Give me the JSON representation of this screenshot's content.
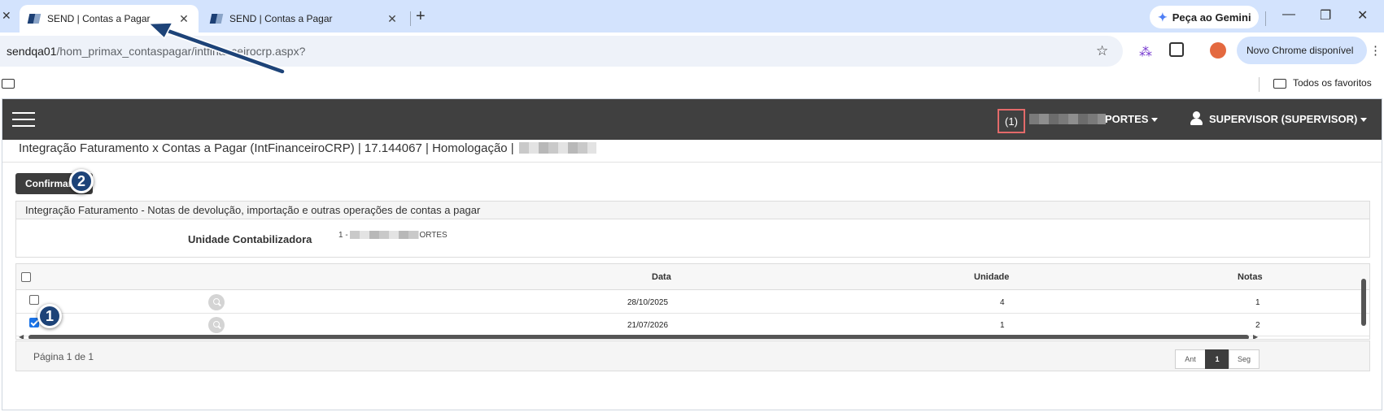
{
  "browser": {
    "tabs": [
      {
        "title": "SEND | Contas a Pagar",
        "active": true
      },
      {
        "title": "SEND | Contas a Pagar",
        "active": false
      }
    ],
    "gemini_label": "Peça ao Gemini",
    "url_host": "sendqa01",
    "url_path": "/hom_primax_contaspagar/intfinanceirocrp.aspx?",
    "update_label": "Novo Chrome disponível",
    "bookmarks_all": "Todos os favoritos"
  },
  "navbar": {
    "count": "(1)",
    "company_suffix": "PORTES",
    "user": "SUPERVISOR (SUPERVISOR)"
  },
  "page": {
    "title": "Integração Faturamento x Contas a Pagar (IntFinanceiroCRP) | 17.144067 | Homologação |"
  },
  "actions": {
    "confirm_label": "Confirmar"
  },
  "panel": {
    "heading": "Integração Faturamento - Notas de devolução, importação e outras operações de contas a pagar",
    "field_label": "Unidade Contabilizadora",
    "field_value_prefix": "1 -",
    "field_value_suffix": "ORTES"
  },
  "grid": {
    "columns": [
      "Data",
      "Unidade",
      "Notas"
    ],
    "rows": [
      {
        "checked": false,
        "data": "28/10/2025",
        "unidade": "4",
        "notas": "1"
      },
      {
        "checked": true,
        "data": "21/07/2026",
        "unidade": "1",
        "notas": "2"
      }
    ]
  },
  "pager": {
    "text": "Página 1 de 1",
    "prev": "Ant",
    "current": "1",
    "next": "Seg"
  },
  "annotations": {
    "step1": "1",
    "step2": "2",
    "badge_color": "#1d4378",
    "arrow_color": "#1d4378"
  }
}
